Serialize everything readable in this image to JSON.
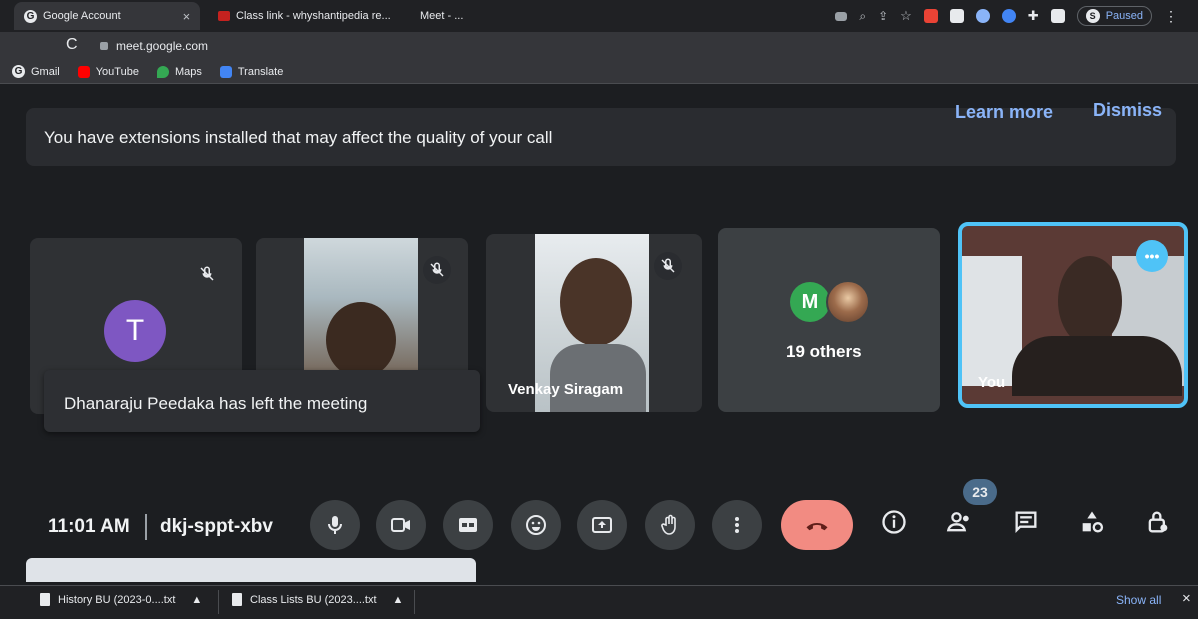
{
  "browser": {
    "tabs": [
      {
        "title": "Google Account",
        "close": "×"
      },
      {
        "title": "Class link - whyshantipedia re..."
      },
      {
        "title": "Meet - ..."
      }
    ],
    "address": {
      "url": "meet.google.com"
    },
    "profile": {
      "initial": "S",
      "status": "Paused"
    },
    "bookmarks": [
      {
        "label": "Gmail",
        "color": "#ea4335"
      },
      {
        "label": "YouTube",
        "color": "#ff0000"
      },
      {
        "label": "Maps",
        "color": "#34a853"
      },
      {
        "label": "Translate",
        "color": "#4285f4"
      }
    ]
  },
  "meet": {
    "notice": {
      "text": "You have extensions installed that may affect the quality of your call",
      "learn_more": "Learn more",
      "dismiss": "Dismiss"
    },
    "tiles": {
      "t_avatar": "T",
      "tile3_name": "Venkay Siragam",
      "others_avatar": "M",
      "others_label": "19 others",
      "self_label": "You",
      "more_label": "•••"
    },
    "toast": "Dhanaraju Peedaka has left the meeting",
    "footer": {
      "time": "11:01 AM",
      "meeting_code": "dkj-sppt-xbv",
      "participants_count": "23"
    },
    "accent_colors": {
      "end_call": "#f28b82",
      "self_border": "#4fc3f7",
      "link": "#8ab4f8"
    }
  },
  "downloads": {
    "items": [
      {
        "name": "History BU (2023-0....txt"
      },
      {
        "name": "Class Lists BU (2023....txt"
      }
    ],
    "show_all": "Show all",
    "close": "×"
  }
}
